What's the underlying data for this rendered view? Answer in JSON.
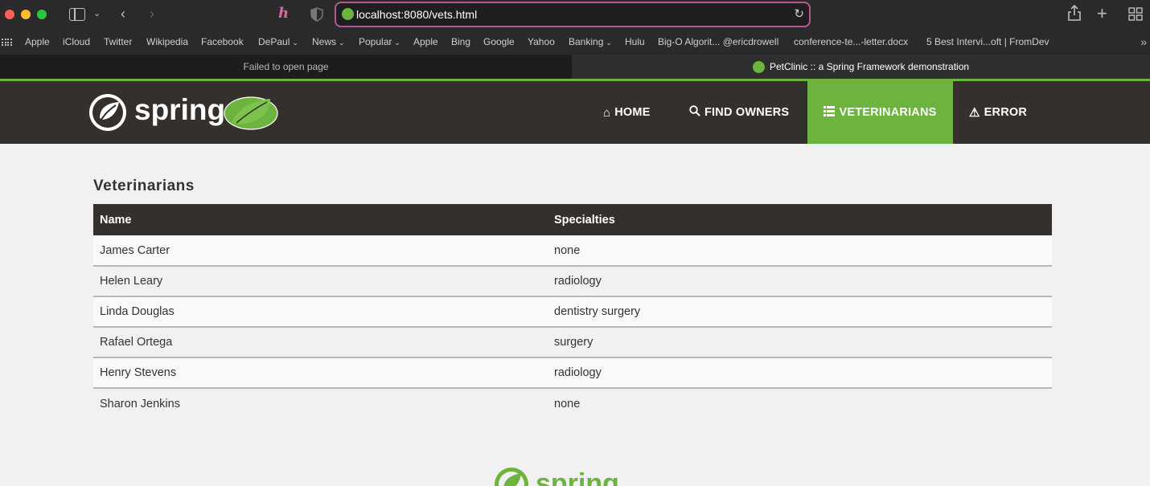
{
  "browser": {
    "url": "localhost:8080/vets.html",
    "bookmarks": [
      {
        "label": "Apple",
        "dropdown": false
      },
      {
        "label": "iCloud",
        "dropdown": false
      },
      {
        "label": "Twitter",
        "dropdown": false
      },
      {
        "label": "Wikipedia",
        "dropdown": false
      },
      {
        "label": "Facebook",
        "dropdown": false
      },
      {
        "label": "DePaul",
        "dropdown": true
      },
      {
        "label": "News",
        "dropdown": true
      },
      {
        "label": "Popular",
        "dropdown": true
      },
      {
        "label": "Apple",
        "dropdown": false
      },
      {
        "label": "Bing",
        "dropdown": false
      },
      {
        "label": "Google",
        "dropdown": false
      },
      {
        "label": "Yahoo",
        "dropdown": false
      },
      {
        "label": "Banking",
        "dropdown": true
      },
      {
        "label": "Hulu",
        "dropdown": false
      },
      {
        "label": "Big-O Algorit... @ericdrowell",
        "dropdown": false
      },
      {
        "label": "conference-te...-letter.docx",
        "dropdown": false
      },
      {
        "label": "5 Best Intervi...oft | FromDev",
        "dropdown": false
      }
    ],
    "tabs": [
      {
        "title": "Failed to open page"
      },
      {
        "title": "PetClinic :: a Spring Framework demonstration"
      }
    ]
  },
  "nav": {
    "logo_text": "spring",
    "items": [
      {
        "label": "HOME",
        "icon": "home-icon"
      },
      {
        "label": "FIND OWNERS",
        "icon": "search-icon"
      },
      {
        "label": "VETERINARIANS",
        "icon": "list-icon"
      },
      {
        "label": "ERROR",
        "icon": "warning-icon"
      }
    ]
  },
  "main": {
    "title": "Veterinarians",
    "columns": [
      "Name",
      "Specialties"
    ],
    "rows": [
      {
        "name": "James Carter",
        "specialties": "none"
      },
      {
        "name": "Helen Leary",
        "specialties": "radiology"
      },
      {
        "name": "Linda Douglas",
        "specialties": "dentistry surgery"
      },
      {
        "name": "Rafael Ortega",
        "specialties": "surgery"
      },
      {
        "name": "Henry Stevens",
        "specialties": "radiology"
      },
      {
        "name": "Sharon Jenkins",
        "specialties": "none"
      }
    ]
  },
  "footer": {
    "logo_text": "spring"
  },
  "colors": {
    "brand_green": "#6db33f",
    "nav_bg": "#34302d",
    "url_border": "#b4598c"
  }
}
